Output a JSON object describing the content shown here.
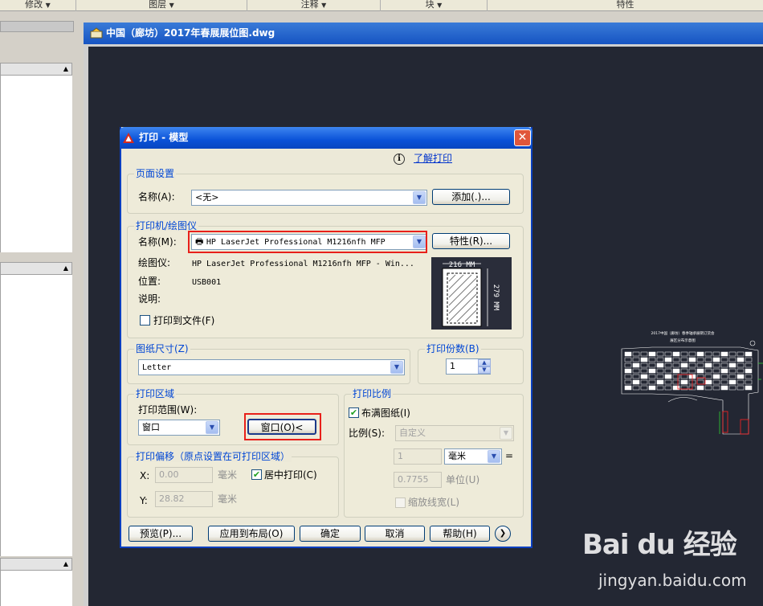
{
  "ribbon": {
    "panels": [
      "修改",
      "图层",
      "注释",
      "块",
      "特性"
    ]
  },
  "drawing": {
    "title": "中国（廊坊）2017年春展展位图.dwg",
    "plan_title_1": "2017中国（廊坊）春季轴承展销订货会",
    "plan_title_2": "展区分布示意图"
  },
  "dialog": {
    "title": "打印 - 模型",
    "learn_link": "了解打印",
    "page_setup": {
      "group": "页面设置",
      "name_label": "名称(A):",
      "name_value": "<无>",
      "add_button": "添加(.)..."
    },
    "printer": {
      "group": "打印机/绘图仪",
      "name_label": "名称(M):",
      "name_value": "HP LaserJet Professional M1216nfh MFP",
      "properties_button": "特性(R)...",
      "plotter_label": "绘图仪:",
      "plotter_value": "HP LaserJet Professional M1216nfh MFP - Win...",
      "where_label": "位置:",
      "where_value": "USB001",
      "desc_label": "说明:",
      "print_to_file": "打印到文件(F)",
      "preview_width": "216 MM",
      "preview_height": "279 MM"
    },
    "paper": {
      "group": "图纸尺寸(Z)",
      "value": "Letter"
    },
    "copies": {
      "group": "打印份数(B)",
      "value": "1"
    },
    "area": {
      "group": "打印区域",
      "range_label": "打印范围(W):",
      "range_value": "窗口",
      "window_button": "窗口(O)<"
    },
    "offset": {
      "group": "打印偏移（原点设置在可打印区域）",
      "x_label": "X:",
      "x_value": "0.00",
      "x_unit": "毫米",
      "y_label": "Y:",
      "y_value": "28.82",
      "y_unit": "毫米",
      "center": "居中打印(C)"
    },
    "scale": {
      "group": "打印比例",
      "fit": "布满图纸(I)",
      "scale_label": "比例(S):",
      "scale_value": "自定义",
      "num_value": "1",
      "unit_value": "毫米",
      "equals": "=",
      "denom_value": "0.7755",
      "units_label": "单位(U)",
      "lineweights": "缩放线宽(L)"
    },
    "buttons": {
      "preview": "预览(P)...",
      "apply": "应用到布局(O)",
      "ok": "确定",
      "cancel": "取消",
      "help": "帮助(H)"
    }
  },
  "watermark": {
    "logo": "Bai du 经验",
    "url": "jingyan.baidu.com"
  }
}
